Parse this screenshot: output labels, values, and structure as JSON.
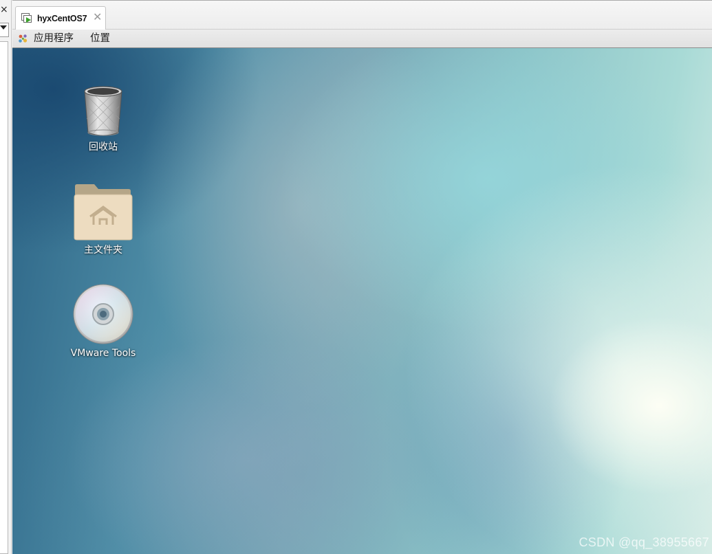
{
  "tab": {
    "title": "hyxCentOS7",
    "close_glyph": "✕",
    "icon": "vm-play-icon"
  },
  "left_pane": {
    "close_glyph": "×"
  },
  "topbar": {
    "apps_label": "应用程序",
    "places_label": "位置",
    "apps_icon": "gnome-foot-icon"
  },
  "desktop": {
    "icons": [
      {
        "label": "回收站",
        "icon": "trash-icon"
      },
      {
        "label": "主文件夹",
        "icon": "home-folder-icon"
      },
      {
        "label": "VMware Tools",
        "icon": "dvd-disc-icon"
      }
    ],
    "watermark": "CSDN @qq_38955667"
  },
  "colors": {
    "wallpaper_dark": "#2c6486",
    "wallpaper_light": "#d6ece6",
    "panel": "#e6e6e6"
  }
}
